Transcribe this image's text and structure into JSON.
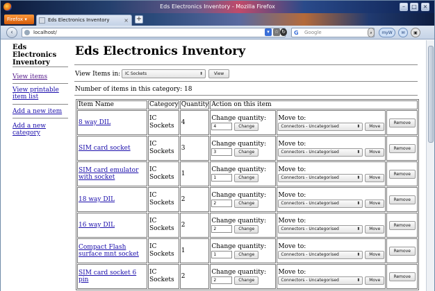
{
  "browser": {
    "window_title": "Eds Electronics Inventory - Mozilla Firefox",
    "app_button": "Firefox",
    "tab_title": "Eds Electronics Inventory",
    "url": "localhost/",
    "search_placeholder": "Google",
    "minimize": "–",
    "maximize": "□",
    "close": "×"
  },
  "sidebar": {
    "site_title": "Eds Electronics Inventory",
    "links": [
      {
        "label": "View items"
      },
      {
        "label": "View printable item list"
      },
      {
        "label": "Add a new item"
      },
      {
        "label": "Add a new category"
      }
    ]
  },
  "main": {
    "page_title": "Eds Electronics Inventory",
    "view_label": "View Items in:",
    "category_selected": "IC Sockets",
    "view_button": "View",
    "count_line": "Number of items in this category: 18"
  },
  "table": {
    "headers": {
      "name": "Item Name",
      "category": "Category",
      "quantity": "Quantity",
      "action": "Action on this item"
    },
    "change_label": "Change quantity:",
    "change_button": "Change",
    "move_label": "Move to:",
    "move_target": "Connectors - Uncategorised",
    "move_button": "Move",
    "remove_button": "Remove",
    "rows": [
      {
        "name": "8 way DIL",
        "category": "IC Sockets",
        "quantity": "4",
        "qty_input": "4"
      },
      {
        "name": "SIM card socket",
        "category": "IC Sockets",
        "quantity": "3",
        "qty_input": "3"
      },
      {
        "name": "SIM card emulator with socket",
        "category": "IC Sockets",
        "quantity": "1",
        "qty_input": "1"
      },
      {
        "name": "18 way DIL",
        "category": "IC Sockets",
        "quantity": "2",
        "qty_input": "2"
      },
      {
        "name": "16 way DIL",
        "category": "IC Sockets",
        "quantity": "2",
        "qty_input": "2"
      },
      {
        "name": "Compact Flash surface mnt socket",
        "category": "IC Sockets",
        "quantity": "1",
        "qty_input": "1"
      },
      {
        "name": "SIM card socket 6 pin",
        "category": "IC Sockets",
        "quantity": "2",
        "qty_input": "2"
      }
    ]
  }
}
